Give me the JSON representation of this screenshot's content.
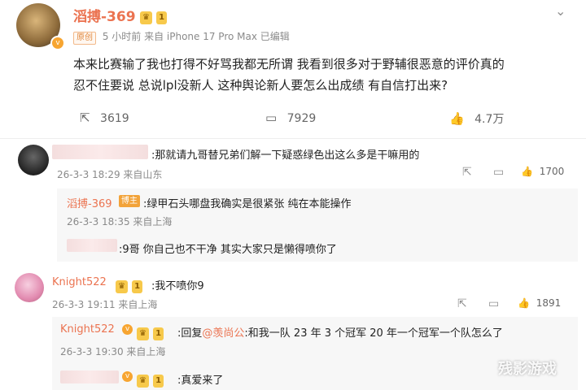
{
  "post": {
    "author": "滔搏-369",
    "level_badge": "1",
    "original_tag": "原创",
    "meta": "5 小时前  来自 iPhone 17 Pro Max 已编辑",
    "text_line1": "本来比赛输了我也打得不好骂我都无所谓  我看到很多对于野辅很恶意的评价真的",
    "text_line2": "忍不住要说 总说lpl没新人 这种舆论新人要怎么出成绩 有自信打出来?",
    "repost_count": "3619",
    "comment_count": "7929",
    "like_count": "4.7万"
  },
  "comments": [
    {
      "text": ":那就请九哥替兄弟们解一下疑惑绿色出这么多是干嘛用的",
      "meta": "26-3-3 18:29 来自山东",
      "likes": "1700",
      "replies": [
        {
          "author": "滔搏-369",
          "author_tag": "博主",
          "text": ":绿甲石头哪盘我确实是很紧张 纯在本能操作",
          "meta": "26-3-3 18:35 来自上海"
        },
        {
          "text": ":9哥 你自己也不干净 其实大家只是懒得喷你了"
        }
      ]
    },
    {
      "author": "Knight522",
      "level_badge": "1",
      "text": ":我不喷你9",
      "meta": "26-3-3 19:11 来自上海",
      "likes": "1891",
      "replies": [
        {
          "author": "Knight522",
          "level_badge": "1",
          "text_prefix": ":回复",
          "mention": "@羡尚公",
          "text": ":和我一队 23 年 3 个冠军 20 年一个冠军一个队怎么了",
          "meta": "26-3-3 19:30 来自上海"
        },
        {
          "level_badge": "1",
          "text": ":真爱来了"
        }
      ]
    }
  ],
  "watermark": "残影游戏",
  "colors": {
    "accent": "#eb7350",
    "muted": "#8a8a8a",
    "link": "#eb7350"
  }
}
